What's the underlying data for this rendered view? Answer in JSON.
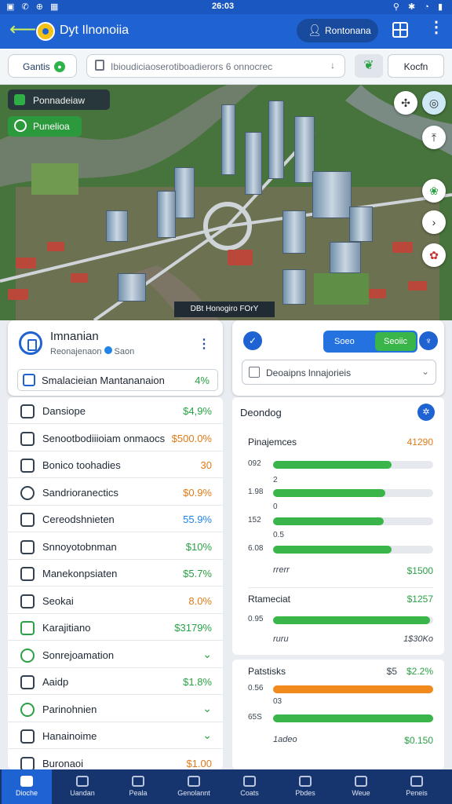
{
  "status": {
    "left": "▣ ✆ ⊕ ▦",
    "time": "26:03",
    "right": "⚲ ✱ ◔ ▮"
  },
  "appbar": {
    "title": "Dyt Ilnonoiia",
    "account_label": "Rontonana"
  },
  "toolbar": {
    "chip_label": "Gantis",
    "search_text": "Ibioudiciaoserotiboadierors  6 onnocrec",
    "right_button": "Kocfn"
  },
  "map": {
    "label_top": "Ponnadeiaw",
    "label_btn": "Punelioa",
    "caption": "DBt Honogiro FOrY"
  },
  "profile": {
    "name": "Imnanian",
    "sub": "Reonajenaon",
    "sub_badge": "Saon",
    "row_label": "Smalacieian Mantananaion",
    "row_value": "4%"
  },
  "segment": {
    "left": "Soeo",
    "right": "Seoiic"
  },
  "dropdown": {
    "label": "Deoaipns lnnajorieis"
  },
  "list": [
    {
      "label": "Dansiope",
      "value": "$4,9%",
      "color": "#2aa145"
    },
    {
      "label": "Senootbodiiioiam onmaocs",
      "value": "$500.0%",
      "color": "#e07b1a"
    },
    {
      "label": "Bonico toohadies",
      "value": "30",
      "color": "#e07b1a"
    },
    {
      "label": "Sandrioranectics",
      "value": "$0.9%",
      "color": "#e07b1a"
    },
    {
      "label": "Cereodshnieten",
      "value": "55.9%",
      "color": "#2185e8"
    },
    {
      "label": "Snnoyotobnman",
      "value": "$10%",
      "color": "#2aa145"
    },
    {
      "label": "Manekonpsiaten",
      "value": "$5.7%",
      "color": "#2aa145"
    },
    {
      "label": "Seokai",
      "value": "8.0%",
      "color": "#e07b1a"
    },
    {
      "label": "Karajitiano",
      "value": "$3179%",
      "color": "#2aa145"
    },
    {
      "label": "Sonrejoamation",
      "value": "",
      "color": "#2aa145"
    },
    {
      "label": "Aaidp",
      "value": "$1.8%",
      "color": "#2aa145"
    },
    {
      "label": "Parinohnien",
      "value": "",
      "color": "#2aa145"
    },
    {
      "label": "Hanainoime",
      "value": "",
      "color": "#2aa145"
    },
    {
      "label": "Buronaoi",
      "value": "$1.00",
      "color": "#e07b1a"
    }
  ],
  "gpanel": {
    "title": "Deondog",
    "sec1": {
      "label": "Pinajemces",
      "value": "41290"
    },
    "sec2": {
      "label": "Rtameciat",
      "value": "$1257"
    },
    "sec2_note_left": "ruru",
    "sec2_note_right": "1$30Ko",
    "sec1_note_left": "rrerr",
    "sec1_note_right": "$1500"
  },
  "gpanel2": {
    "title": "Patstisks",
    "mid": "$5",
    "value": "$2.2%",
    "note_left": "1adeo",
    "note_right": "$0.150"
  },
  "chart_data": [
    {
      "type": "bar",
      "title": "Pinajemces",
      "categories": [
        "092",
        "1.98",
        "152",
        "6.08"
      ],
      "values": [
        0.74,
        0.7,
        0.69,
        0.74
      ],
      "colors": [
        "#39b54a",
        "#39b54a",
        "#39b54a",
        "#39b54a"
      ],
      "ticks": [
        "2",
        "0",
        "0.5"
      ]
    },
    {
      "type": "bar",
      "title": "Rtameciat",
      "categories": [
        "0.95"
      ],
      "values": [
        0.98
      ],
      "colors": [
        "#39b54a"
      ]
    },
    {
      "type": "bar",
      "title": "Patstisks",
      "categories": [
        "0.56",
        "65S"
      ],
      "values": [
        1.0,
        1.0
      ],
      "colors": [
        "#f08a1c",
        "#39b54a"
      ],
      "ticks": [
        "03"
      ]
    }
  ],
  "bottomnav": [
    "Dioche",
    "Uandan",
    "Peala",
    "Genolannt",
    "Coats",
    "Pbdes",
    "Weue",
    "Peneis"
  ]
}
